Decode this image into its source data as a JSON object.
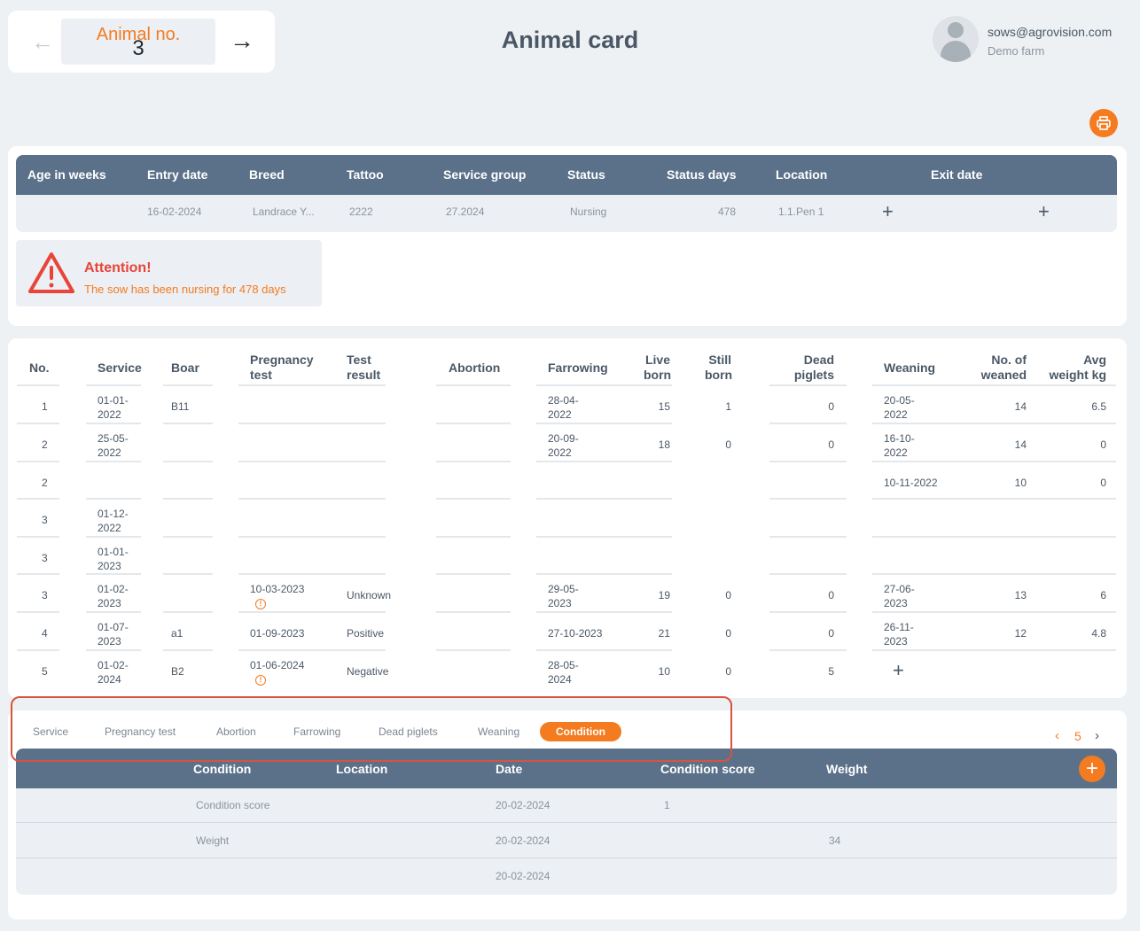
{
  "header": {
    "animal_label": "Animal no.",
    "animal_no": "3",
    "back_icon": "←",
    "forward_icon": "→",
    "title": "Animal card",
    "user_email": "sows@agrovision.com",
    "farm": "Demo farm"
  },
  "info": {
    "columns": [
      "Age in weeks",
      "Entry date",
      "Breed",
      "Tattoo",
      "Service group",
      "Status",
      "Status days",
      "Location",
      "Exit date"
    ],
    "values": {
      "age_in_weeks": "",
      "entry_date": "16-02-2024",
      "breed": "Landrace Y...",
      "tattoo": "2222",
      "service_group": "27.2024",
      "status": "Nursing",
      "status_days": "478",
      "location": "1.1.Pen 1"
    },
    "plus": "+"
  },
  "alert": {
    "title": "Attention!",
    "message": "The sow has been nursing for 478 days"
  },
  "history": {
    "columns": {
      "no": "No.",
      "service": "Service",
      "boar": "Boar",
      "pregnancy_test_1": "Pregnancy",
      "pregnancy_test_2": "test",
      "test_result_1": "Test",
      "test_result_2": "result",
      "abortion": "Abortion",
      "farrowing": "Farrowing",
      "live_born_1": "Live",
      "live_born_2": "born",
      "still_born_1": "Still",
      "still_born_2": "born",
      "dead_piglets_1": "Dead",
      "dead_piglets_2": "piglets",
      "weaning": "Weaning",
      "no_weaned_1": "No. of",
      "no_weaned_2": "weaned",
      "avg_weight_1": "Avg",
      "avg_weight_2": "weight kg"
    },
    "rows": [
      {
        "no": "1",
        "service_1": "01-01-",
        "service_2": "2022",
        "boar": "B11",
        "preg_1": "",
        "preg_warn": "",
        "result": "",
        "farrow_1": "28-04-",
        "farrow_2": "2022",
        "live": "15",
        "still": "1",
        "dead": "0",
        "wean_1": "20-05-",
        "wean_2": "2022",
        "weaned": "14",
        "avg": "6.5"
      },
      {
        "no": "2",
        "service_1": "25-05-",
        "service_2": "2022",
        "boar": "",
        "preg_1": "",
        "preg_warn": "",
        "result": "",
        "farrow_1": "20-09-",
        "farrow_2": "2022",
        "live": "18",
        "still": "0",
        "dead": "0",
        "wean_1": "16-10-",
        "wean_2": "2022",
        "weaned": "14",
        "avg": "0"
      },
      {
        "no": "2",
        "service_1": "",
        "service_2": "",
        "boar": "",
        "preg_1": "",
        "preg_warn": "",
        "result": "",
        "farrow_1": "",
        "farrow_2": "",
        "live": "",
        "still": "",
        "dead": "",
        "wean_1": "10-11-2022",
        "wean_2": "",
        "weaned": "10",
        "avg": "0"
      },
      {
        "no": "3",
        "service_1": "01-12-",
        "service_2": "2022",
        "boar": "",
        "preg_1": "",
        "preg_warn": "",
        "result": "",
        "farrow_1": "",
        "farrow_2": "",
        "live": "",
        "still": "",
        "dead": "",
        "wean_1": "",
        "wean_2": "",
        "weaned": "",
        "avg": ""
      },
      {
        "no": "3",
        "service_1": "01-01-",
        "service_2": "2023",
        "boar": "",
        "preg_1": "",
        "preg_warn": "",
        "result": "",
        "farrow_1": "",
        "farrow_2": "",
        "live": "",
        "still": "",
        "dead": "",
        "wean_1": "",
        "wean_2": "",
        "weaned": "",
        "avg": ""
      },
      {
        "no": "3",
        "service_1": "01-02-",
        "service_2": "2023",
        "boar": "",
        "preg_1": "10-03-2023",
        "preg_warn": "!",
        "result": "Unknown",
        "farrow_1": "29-05-",
        "farrow_2": "2023",
        "live": "19",
        "still": "0",
        "dead": "0",
        "wean_1": "27-06-",
        "wean_2": "2023",
        "weaned": "13",
        "avg": "6"
      },
      {
        "no": "4",
        "service_1": "01-07-",
        "service_2": "2023",
        "boar": "a1",
        "preg_1": "01-09-2023",
        "preg_warn": "",
        "result": "Positive",
        "farrow_1": "27-10-2023",
        "farrow_2": "",
        "live": "21",
        "still": "0",
        "dead": "0",
        "wean_1": "26-11-",
        "wean_2": "2023",
        "weaned": "12",
        "avg": "4.8"
      },
      {
        "no": "5",
        "service_1": "01-02-",
        "service_2": "2024",
        "boar": "B2",
        "preg_1": "01-06-2024",
        "preg_warn": "!",
        "result": "Negative",
        "farrow_1": "28-05-",
        "farrow_2": "2024",
        "live": "10",
        "still": "0",
        "dead": "5",
        "wean_1": "",
        "wean_2": "",
        "weaned": "",
        "avg": ""
      }
    ],
    "plus": "+"
  },
  "tabs": [
    {
      "label": "Service"
    },
    {
      "label": "Pregnancy test"
    },
    {
      "label": "Abortion"
    },
    {
      "label": "Farrowing"
    },
    {
      "label": "Dead piglets"
    },
    {
      "label": "Weaning"
    },
    {
      "label": "Condition"
    }
  ],
  "active_tab": "Condition",
  "pager": {
    "prev": "‹",
    "page": "5",
    "next": "›"
  },
  "condition": {
    "columns": [
      "Condition",
      "Location",
      "Date",
      "Condition score",
      "Weight"
    ],
    "add": "+",
    "rows": [
      {
        "condition": "Condition score",
        "location": "",
        "date": "20-02-2024",
        "score": "1",
        "weight": ""
      },
      {
        "condition": "Weight",
        "location": "",
        "date": "20-02-2024",
        "score": "",
        "weight": "34"
      },
      {
        "condition": "",
        "location": "",
        "date": "20-02-2024",
        "score": "",
        "weight": ""
      }
    ]
  },
  "colors": {
    "accent": "#f47b20",
    "header": "#5b7189",
    "alert": "#e8443a",
    "highlight": "#d8533e"
  }
}
